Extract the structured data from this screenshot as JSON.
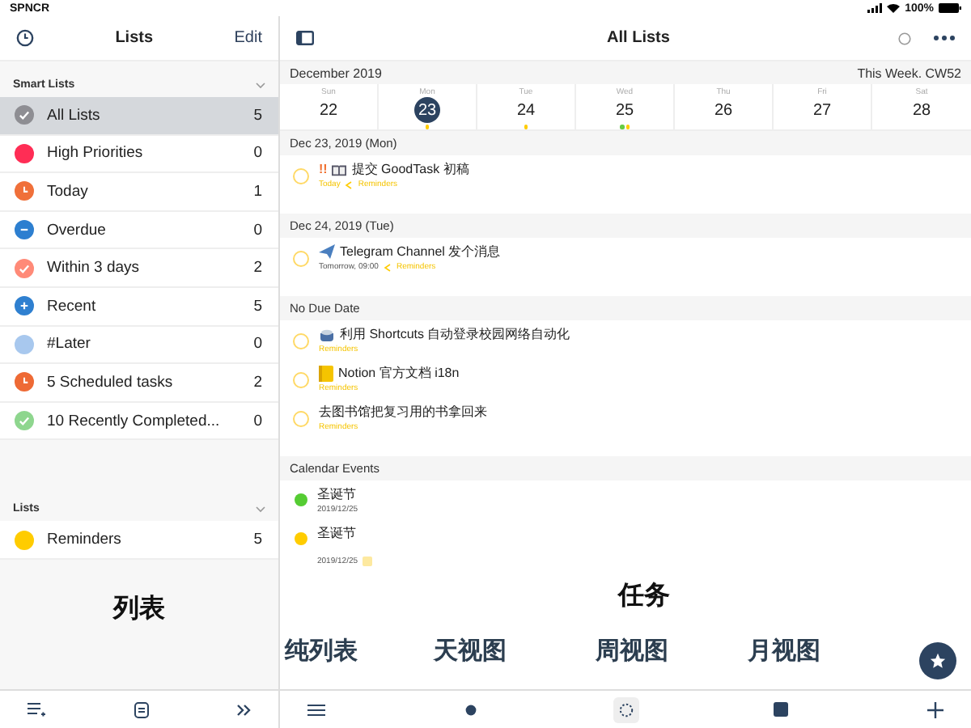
{
  "status_bar": {
    "carrier": "SPNCR",
    "battery": "100%"
  },
  "sidebar": {
    "title": "Lists",
    "edit": "Edit",
    "sections": [
      {
        "title": "Smart Lists",
        "expanded": true,
        "items": [
          {
            "label": "All Lists",
            "count": "5",
            "color": "#8e8e93",
            "selected": true,
            "kind": "check"
          },
          {
            "label": "High Priorities",
            "count": "0",
            "color": "#ff2d55",
            "selected": false,
            "kind": "dot"
          },
          {
            "label": "Today",
            "count": "1",
            "color": "#f0703a",
            "selected": false,
            "kind": "clock"
          },
          {
            "label": "Overdue",
            "count": "0",
            "color": "#2d7fd0",
            "selected": false,
            "kind": "minus"
          },
          {
            "label": "Within 3 days",
            "count": "2",
            "color": "#ff8a78",
            "selected": false,
            "kind": "check"
          },
          {
            "label": "Recent",
            "count": "5",
            "color": "#2f80d0",
            "selected": false,
            "kind": "plus"
          },
          {
            "label": "#Later",
            "count": "0",
            "color": "#a8c8ee",
            "selected": false,
            "kind": "dot"
          },
          {
            "label": "5 Scheduled tasks",
            "count": "2",
            "color": "#ee6a35",
            "selected": false,
            "kind": "clock"
          },
          {
            "label": "10 Recently Completed...",
            "count": "0",
            "color": "#8ed68e",
            "selected": false,
            "kind": "check"
          }
        ]
      },
      {
        "title": "Lists",
        "expanded": true,
        "items": [
          {
            "label": "Reminders",
            "count": "5",
            "color": "#ffcc00",
            "selected": false,
            "kind": "dot"
          }
        ]
      }
    ]
  },
  "main": {
    "title": "All Lists",
    "month": "December 2019",
    "week_label": "This Week. CW52",
    "days": [
      {
        "weekday": "Sun",
        "day": "22",
        "selected": false
      },
      {
        "weekday": "Mon",
        "day": "23",
        "selected": true,
        "dots": [
          {
            "color": "#ffcc00"
          }
        ]
      },
      {
        "weekday": "Tue",
        "day": "24",
        "selected": false,
        "dots": [
          {
            "color": "#ffcc00"
          }
        ]
      },
      {
        "weekday": "Wed",
        "day": "25",
        "selected": false,
        "dots": [
          {
            "color": "#66cc44"
          },
          {
            "color": "#ffcc00"
          }
        ]
      },
      {
        "weekday": "Thu",
        "day": "26",
        "selected": false
      },
      {
        "weekday": "Fri",
        "day": "27",
        "selected": false
      },
      {
        "weekday": "Sat",
        "day": "28",
        "selected": false
      }
    ],
    "groups": [
      {
        "title": "Dec 23, 2019 (Mon)",
        "items": [
          {
            "kind": "book",
            "checked": false,
            "priority": "!!",
            "title": "提交 GoodTask 初稿",
            "date": "Today",
            "highlighted": true,
            "list": "Reminders"
          }
        ]
      },
      {
        "title": "Dec 24, 2019 (Tue)",
        "items": [
          {
            "kind": "plane",
            "checked": false,
            "title": "Telegram Channel 发个消息",
            "date": "Tomorrow, 09:00",
            "highlighted": false,
            "list": "Reminders"
          }
        ]
      },
      {
        "title": "No Due Date",
        "items": [
          {
            "kind": "pot",
            "checked": false,
            "title": "利用 Shortcuts 自动登录校园网络自动化",
            "list": "Reminders"
          },
          {
            "kind": "notebook",
            "checked": false,
            "title": "Notion 官方文档 i18n",
            "list": "Reminders"
          },
          {
            "kind": "task",
            "checked": false,
            "title": "去图书馆把复习用的书拿回来",
            "list": "Reminders"
          }
        ]
      },
      {
        "title": "Calendar Events",
        "items": [
          {
            "kind": "event",
            "color": "#55cc33",
            "title": "圣诞节",
            "date": "2019/12/25"
          },
          {
            "kind": "event",
            "color": "#ffcc00",
            "title": "圣诞节",
            "date": "2019/12/25",
            "note": true
          }
        ]
      }
    ]
  },
  "annotations": {
    "sidebar": "列表",
    "main": "任务",
    "views": [
      "纯列表",
      "天视图",
      "周视图",
      "月视图"
    ]
  }
}
